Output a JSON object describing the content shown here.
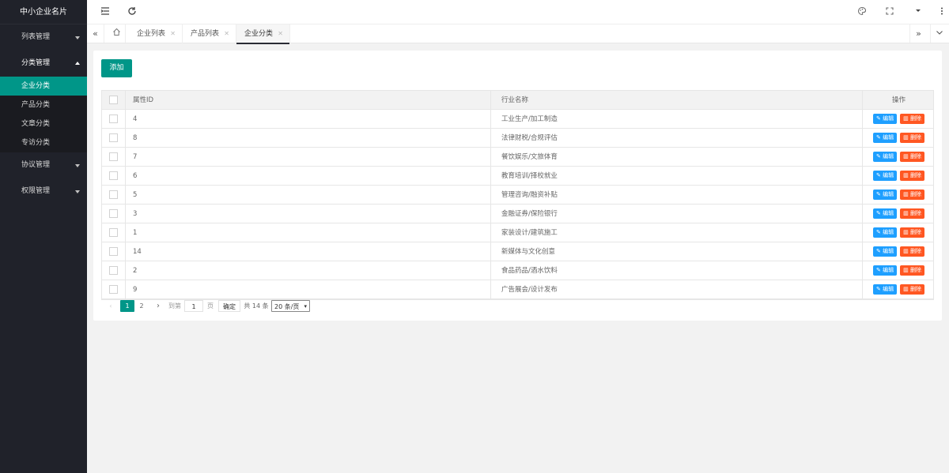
{
  "app": {
    "title": "中小企业名片"
  },
  "sidebar": {
    "groups": [
      {
        "label": "列表管理",
        "open": false
      },
      {
        "label": "分类管理",
        "open": true,
        "items": [
          "企业分类",
          "产品分类",
          "文章分类",
          "专访分类"
        ]
      },
      {
        "label": "协议管理",
        "open": false
      },
      {
        "label": "权限管理",
        "open": false
      }
    ],
    "active_item": "企业分类"
  },
  "topbar": {
    "icons": [
      "menu-fold-icon",
      "refresh-icon",
      "theme-icon",
      "fullscreen-icon",
      "dropdown-caret-icon",
      "more-vertical-icon"
    ]
  },
  "tabs": {
    "items": [
      {
        "label": "企业列表",
        "active": false
      },
      {
        "label": "产品列表",
        "active": false
      },
      {
        "label": "企业分类",
        "active": true
      }
    ]
  },
  "toolbar": {
    "add_label": "添加"
  },
  "table": {
    "headers": {
      "id": "属性ID",
      "name": "行业名称",
      "op": "操作"
    },
    "edit_label": "编辑",
    "delete_label": "删除",
    "rows": [
      {
        "id": "4",
        "name": "工业生产/加工制造"
      },
      {
        "id": "8",
        "name": "法律财税/合规评估"
      },
      {
        "id": "7",
        "name": "餐饮娱乐/文旅体育"
      },
      {
        "id": "6",
        "name": "教育培训/择校就业"
      },
      {
        "id": "5",
        "name": "管理咨询/融资补贴"
      },
      {
        "id": "3",
        "name": "金融证券/保险银行"
      },
      {
        "id": "1",
        "name": "家装设计/建筑施工"
      },
      {
        "id": "14",
        "name": "新媒体与文化创意"
      },
      {
        "id": "2",
        "name": "食品药品/酒水饮料"
      },
      {
        "id": "9",
        "name": "广告展会/设计发布"
      }
    ]
  },
  "pager": {
    "current": "1",
    "page2": "2",
    "goto_label": "到第",
    "goto_value": "1",
    "page_unit": "页",
    "confirm_label": "确定",
    "total_label": "共 14 条",
    "page_size": "20 条/页"
  },
  "colors": {
    "accent": "#009688",
    "sidebar": "#20222a",
    "edit": "#1e9fff",
    "delete": "#ff5722"
  }
}
